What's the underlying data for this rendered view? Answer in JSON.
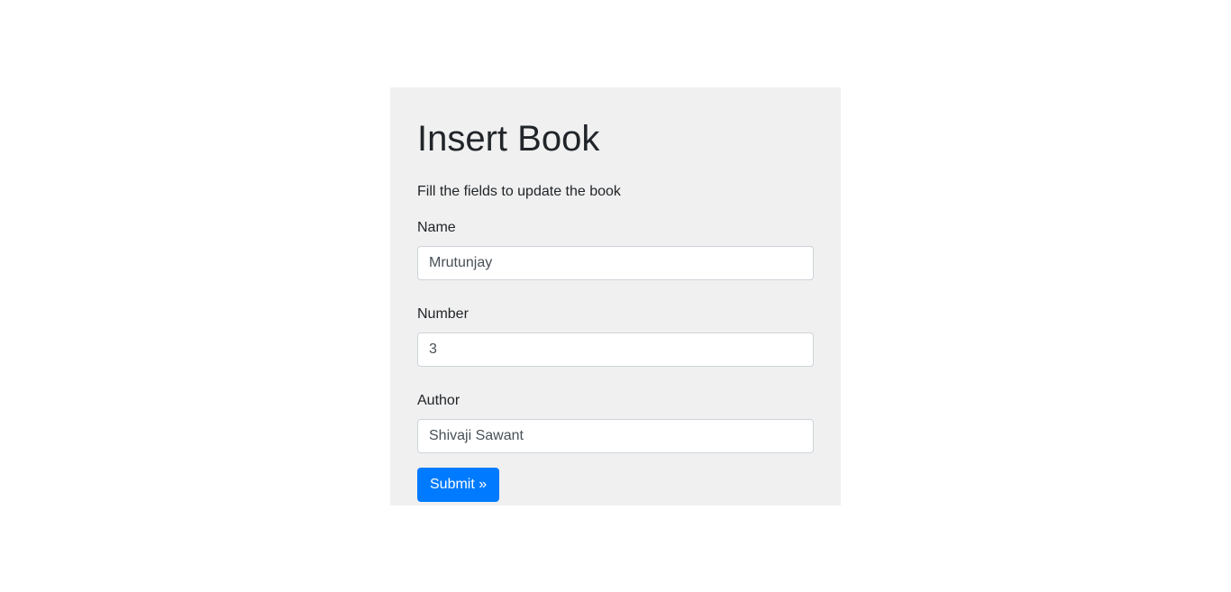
{
  "form": {
    "title": "Insert Book",
    "subtitle": "Fill the fields to update the book",
    "fields": [
      {
        "label": "Name",
        "value": "Mrutunjay"
      },
      {
        "label": "Number",
        "value": "3"
      },
      {
        "label": "Author",
        "value": "Shivaji Sawant"
      }
    ],
    "submit_label": "Submit »"
  },
  "colors": {
    "card_background": "#f0f0f0",
    "primary_button": "#007bff",
    "text": "#212529",
    "input_border": "#ced4da"
  }
}
